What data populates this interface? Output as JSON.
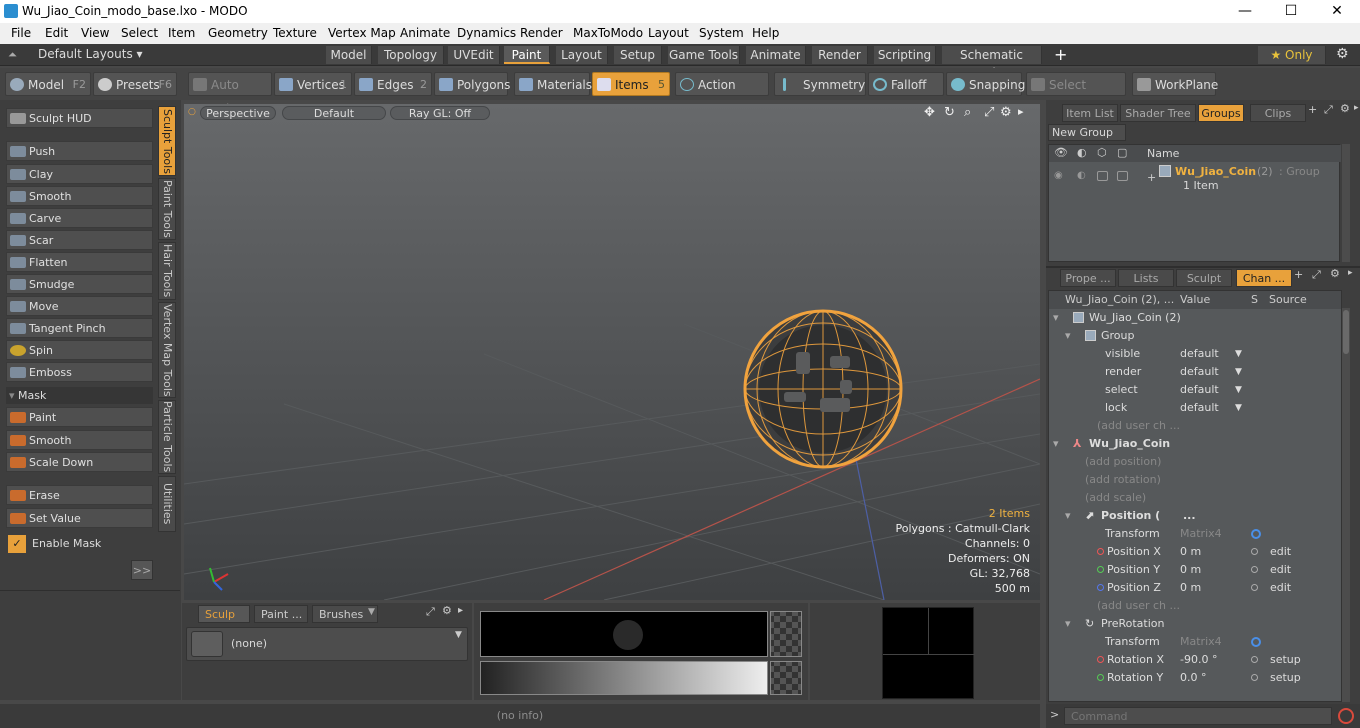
{
  "window": {
    "title": "Wu_Jiao_Coin_modo_base.lxo - MODO",
    "minimize": "—",
    "maximize": "☐",
    "close": "✕"
  },
  "menu": [
    "File",
    "Edit",
    "View",
    "Select",
    "Item",
    "Geometry",
    "Texture",
    "Vertex Map",
    "Animate",
    "Dynamics",
    "Render",
    "MaxToModo",
    "Layout",
    "System",
    "Help"
  ],
  "layouts": {
    "default": "Default Layouts ▾",
    "tabs": [
      "Model",
      "Topology",
      "UVEdit",
      "Paint",
      "Layout",
      "Setup",
      "Game Tools",
      "Animate",
      "Render",
      "Scripting",
      "Schematic Fusion"
    ],
    "active": "Paint",
    "plus": "+",
    "only": "★  Only"
  },
  "toolbar": {
    "model": "Model",
    "model_sc": "F2",
    "presets": "Presets",
    "presets_sc": "F6",
    "auto_select": "Auto Select",
    "vertices": "Vertices",
    "vertices_sc": "1",
    "edges": "Edges",
    "edges_sc": "2",
    "polygons": "Polygons",
    "materials": "Materials",
    "items": "Items",
    "items_sc": "5",
    "action_center": "Action Center",
    "symmetry": "Symmetry",
    "falloff": "Falloff",
    "snapping": "Snapping",
    "select_through": "Select Through",
    "workplane": "WorkPlane"
  },
  "sculpt": {
    "hud": "Sculpt HUD",
    "tools": [
      "Push",
      "Clay",
      "Smooth",
      "Carve",
      "Scar",
      "Flatten",
      "Smudge",
      "Move",
      "Tangent Pinch",
      "Spin",
      "Emboss"
    ],
    "mask_header": "Mask",
    "mask_tools": [
      "Paint",
      "Smooth",
      "Scale Down"
    ],
    "extra_tools": [
      "Erase",
      "Set Value"
    ],
    "enable_mask": "Enable Mask",
    "expand": ">>"
  },
  "vtabs": [
    "Sculpt Tools",
    "Paint Tools",
    "Hair Tools",
    "Vertex Map Tools",
    "Particle Tools",
    "Utilities"
  ],
  "viewport": {
    "perspective": "Perspective",
    "default": "Default",
    "raygl": "Ray GL: Off",
    "info": [
      "2 Items",
      "Polygons : Catmull-Clark",
      "Channels: 0",
      "Deformers: ON",
      "GL: 32,768",
      "500 m"
    ]
  },
  "bottom": {
    "tabs": [
      "Sculp ...",
      "Paint ...",
      "Brushes"
    ],
    "preset": "(none)"
  },
  "status": "(no info)",
  "items_panel": {
    "tabs": [
      "Item List",
      "Shader Tree",
      "Groups",
      "Clips"
    ],
    "active": "Groups",
    "new_group": "New Group",
    "name_header": "Name",
    "group_name": "Wu_Jiao_Coin",
    "group_count": "(2)",
    "group_type": ": Group",
    "group_items": "1 Item"
  },
  "channels": {
    "tabs": [
      "Prope ...",
      "Lists",
      "Sculpt",
      "Chan ..."
    ],
    "active": "Chan ...",
    "headers": [
      "Wu_Jiao_Coin (2), ...",
      "Value",
      "S",
      "Source"
    ],
    "rows": [
      {
        "name": "Wu_Jiao_Coin (2)",
        "value": "",
        "src": ""
      },
      {
        "name": "Group",
        "value": "",
        "src": ""
      },
      {
        "name": "visible",
        "value": "default",
        "src": ""
      },
      {
        "name": "render",
        "value": "default",
        "src": ""
      },
      {
        "name": "select",
        "value": "default",
        "src": ""
      },
      {
        "name": "lock",
        "value": "default",
        "src": ""
      },
      {
        "name": "(add user ch ...",
        "value": "",
        "src": ""
      },
      {
        "name": "Wu_Jiao_Coin",
        "value": "",
        "src": ""
      },
      {
        "name": "(add position)",
        "value": "",
        "src": ""
      },
      {
        "name": "(add rotation)",
        "value": "",
        "src": ""
      },
      {
        "name": "(add scale)",
        "value": "",
        "src": ""
      },
      {
        "name": "Position (",
        "value": "...",
        "src": ""
      },
      {
        "name": "Transform",
        "value": "Matrix4",
        "src": ""
      },
      {
        "name": "Position X",
        "value": "0 m",
        "src": "edit"
      },
      {
        "name": "Position Y",
        "value": "0 m",
        "src": "edit"
      },
      {
        "name": "Position Z",
        "value": "0 m",
        "src": "edit"
      },
      {
        "name": "(add user ch ...",
        "value": "",
        "src": ""
      },
      {
        "name": "PreRotation",
        "value": "",
        "src": ""
      },
      {
        "name": "Transform",
        "value": "Matrix4",
        "src": ""
      },
      {
        "name": "Rotation X",
        "value": "-90.0 °",
        "src": "setup"
      },
      {
        "name": "Rotation Y",
        "value": "0.0 °",
        "src": "setup"
      }
    ]
  },
  "command": {
    "placeholder": "Command"
  }
}
